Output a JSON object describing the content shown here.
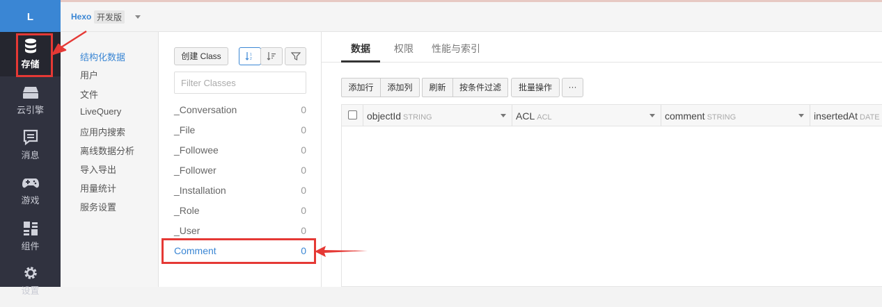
{
  "colors": {
    "accent": "#3a86d4",
    "nav_bg": "#30323f",
    "annotation": "#e53935"
  },
  "nav": {
    "logo": "L",
    "items": [
      {
        "label": "存储",
        "icon": "database-icon"
      },
      {
        "label": "云引擎",
        "icon": "server-icon"
      },
      {
        "label": "消息",
        "icon": "message-icon"
      },
      {
        "label": "游戏",
        "icon": "gamepad-icon"
      },
      {
        "label": "组件",
        "icon": "components-icon"
      },
      {
        "label": "设置",
        "icon": "gear-icon"
      }
    ]
  },
  "header": {
    "app_name": "Hexo",
    "env": "开发版"
  },
  "submenu": {
    "items": [
      "结构化数据",
      "用户",
      "文件",
      "LiveQuery",
      "应用内搜索",
      "离线数据分析",
      "导入导出",
      "用量统计",
      "服务设置"
    ]
  },
  "classes": {
    "create_label": "创建 Class",
    "filter_placeholder": "Filter Classes",
    "list": [
      {
        "name": "_Conversation",
        "count": "0"
      },
      {
        "name": "_File",
        "count": "0"
      },
      {
        "name": "_Followee",
        "count": "0"
      },
      {
        "name": "_Follower",
        "count": "0"
      },
      {
        "name": "_Installation",
        "count": "0"
      },
      {
        "name": "_Role",
        "count": "0"
      },
      {
        "name": "_User",
        "count": "0"
      },
      {
        "name": "Comment",
        "count": "0"
      }
    ]
  },
  "main": {
    "tabs": [
      "数据",
      "权限",
      "性能与索引"
    ],
    "toolbar": {
      "add_row": "添加行",
      "add_col": "添加列",
      "refresh": "刷新",
      "filter": "按条件过滤",
      "batch": "批量操作",
      "more": "···"
    },
    "columns": [
      {
        "name": "objectId",
        "type": "STRING"
      },
      {
        "name": "ACL",
        "type": "ACL"
      },
      {
        "name": "comment",
        "type": "STRING"
      },
      {
        "name": "insertedAt",
        "type": "DATE"
      }
    ]
  }
}
